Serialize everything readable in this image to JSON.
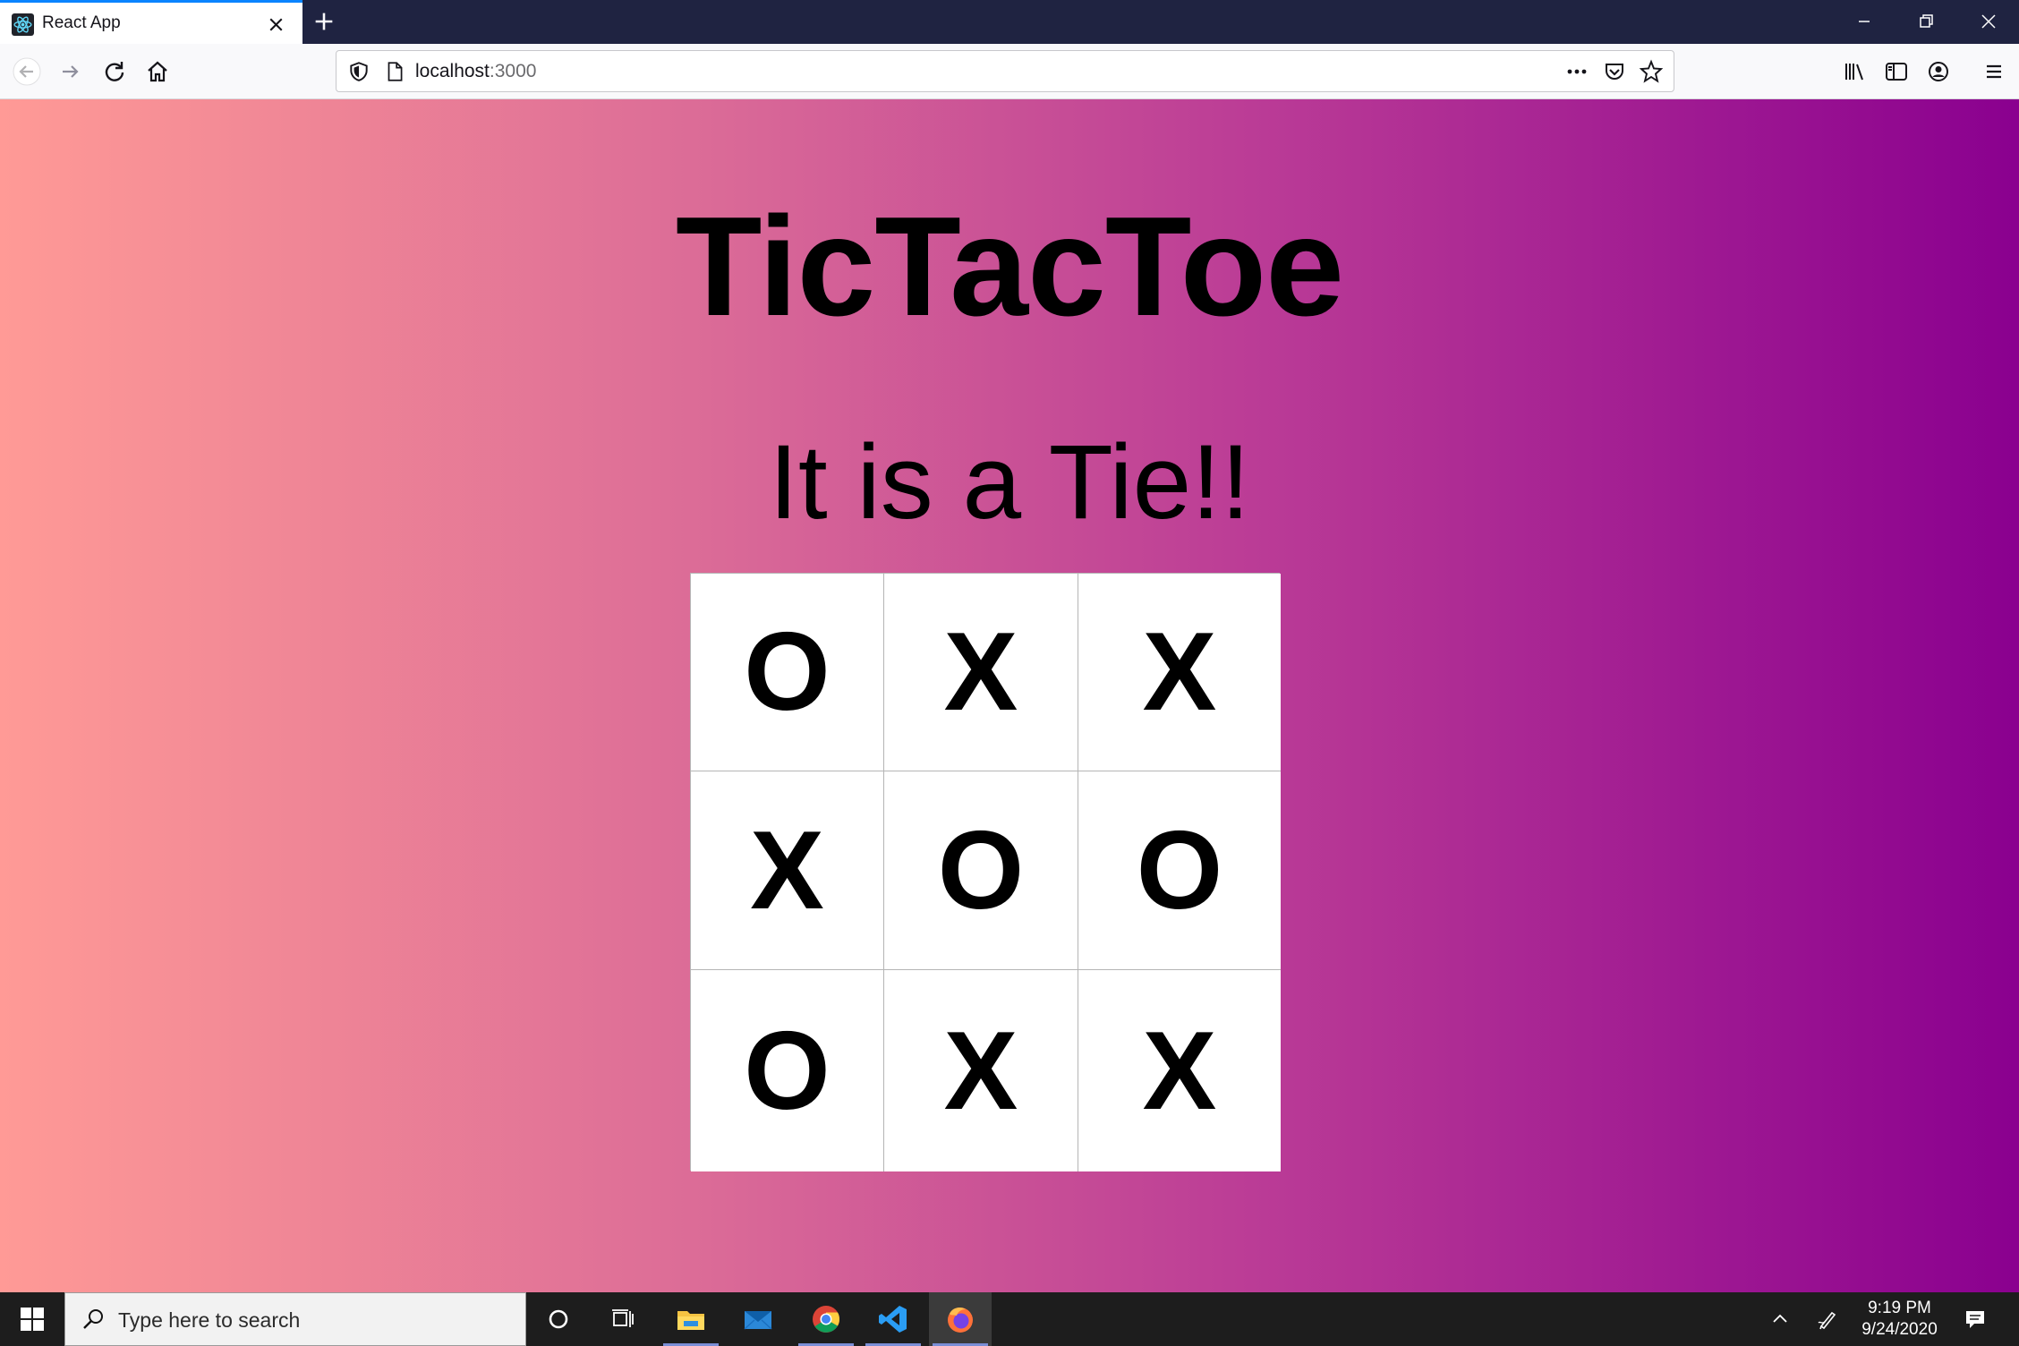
{
  "browser": {
    "tab": {
      "title": "React App"
    },
    "urlbar": {
      "host": "localhost",
      "port": ":3000"
    }
  },
  "game": {
    "title": "TicTacToe",
    "status": "It is a Tie!!",
    "board": [
      [
        "O",
        "X",
        "X"
      ],
      [
        "X",
        "O",
        "O"
      ],
      [
        "O",
        "X",
        "X"
      ]
    ]
  },
  "taskbar": {
    "search_placeholder": "Type here to search",
    "time": "9:19 PM",
    "date": "9/24/2020"
  },
  "colors": {
    "gradient_start": "#ff9a96",
    "gradient_end": "#8a008f",
    "tab_accent": "#0a84ff"
  }
}
